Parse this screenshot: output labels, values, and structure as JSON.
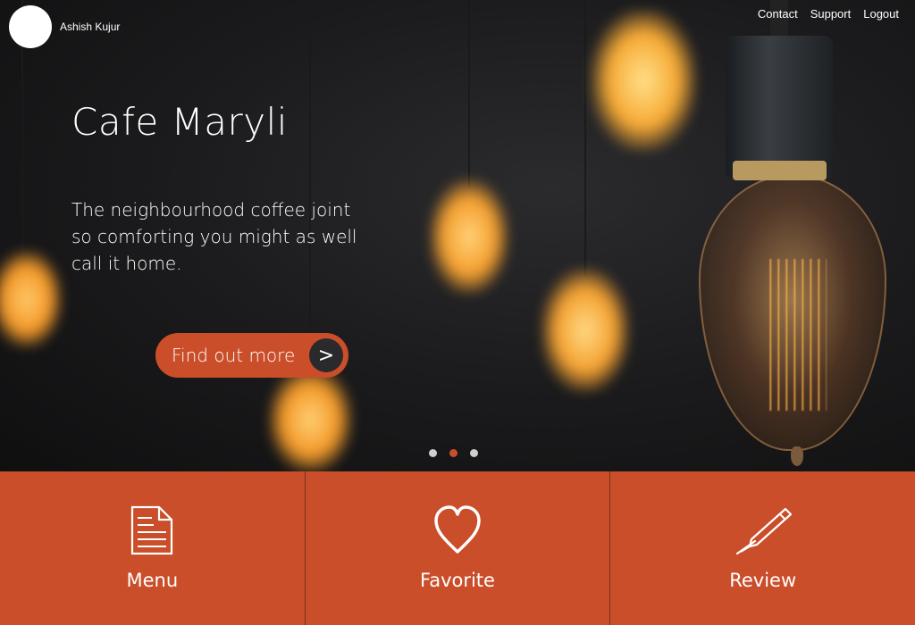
{
  "header": {
    "user_name": "Ashish Kujur",
    "nav": [
      "Contact",
      "Support",
      "Logout"
    ]
  },
  "hero": {
    "title": "Cafe Maryli",
    "tagline": "The neighbourhood coffee joint so comforting you might as well call it home.",
    "cta_label": "Find out more",
    "cta_arrow": ">",
    "carousel": {
      "slides": 3,
      "active_index": 1
    }
  },
  "tiles": [
    {
      "label": "Menu",
      "icon": "document-icon"
    },
    {
      "label": "Favorite",
      "icon": "heart-icon"
    },
    {
      "label": "Review",
      "icon": "pen-icon"
    }
  ],
  "colors": {
    "accent": "#c94e29",
    "dark_button": "#2a2a2c",
    "dot_inactive": "#cfcfcf"
  }
}
